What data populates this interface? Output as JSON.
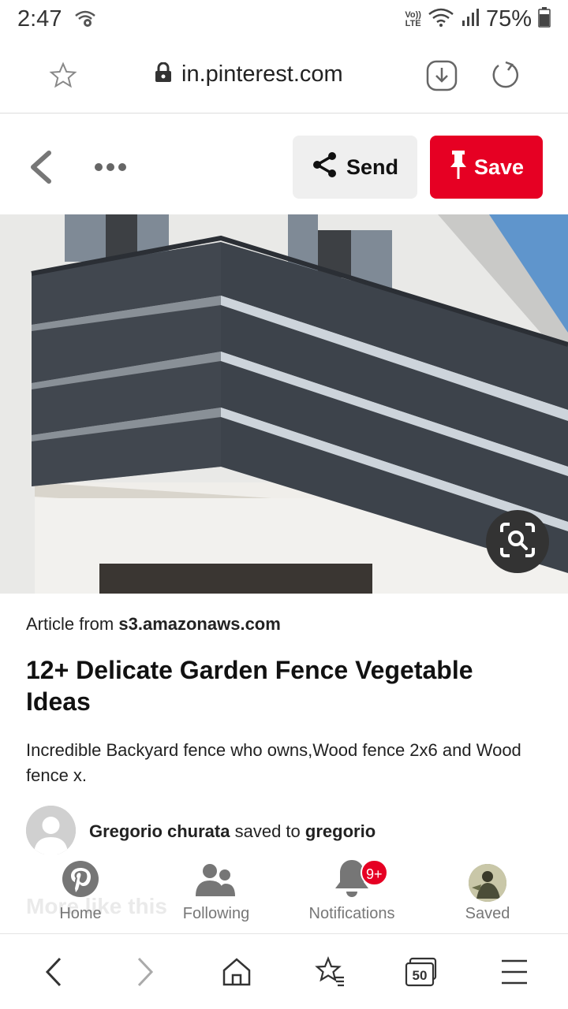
{
  "status_bar": {
    "time": "2:47",
    "volte_line1": "Vo))",
    "volte_line2": "LTE",
    "battery": "75%"
  },
  "url_bar": {
    "url": "in.pinterest.com"
  },
  "pin_header": {
    "send_label": "Send",
    "save_label": "Save"
  },
  "pin": {
    "article_prefix": "Article from",
    "article_source": "s3.amazonaws.com",
    "title": "12+ Delicate Garden Fence Vegetable Ideas",
    "description": "Incredible Backyard fence who owns,Wood fence 2x6 and Wood fence x.",
    "saver_name": "Gregorio churata",
    "saved_to_text": "saved to",
    "board_name": "gregorio",
    "more_like_this": "More like this"
  },
  "pinterest_nav": {
    "items": [
      {
        "label": "Home",
        "icon": "pinterest-logo-icon"
      },
      {
        "label": "Following",
        "icon": "people-icon"
      },
      {
        "label": "Notifications",
        "icon": "bell-icon",
        "badge": "9+"
      },
      {
        "label": "Saved",
        "icon": "profile-avatar"
      }
    ]
  },
  "browser_nav": {
    "tabs_count": "50"
  },
  "colors": {
    "accent": "#e60023",
    "fence": "#3d434b"
  }
}
